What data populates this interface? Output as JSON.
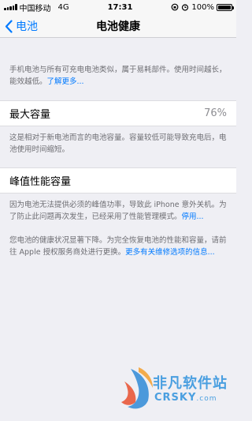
{
  "status_bar": {
    "carrier": "中国移动",
    "network": "4G",
    "time": "17:31",
    "battery_percent": "100%",
    "battery_level": 1.0
  },
  "nav": {
    "back_label": "电池",
    "title": "电池健康"
  },
  "intro": {
    "text": "手机电池与所有可充电电池类似，属于易耗部件。使用时间越长，能效越低。",
    "link": "了解更多..."
  },
  "max_capacity": {
    "label": "最大容量",
    "value": "76%",
    "desc": "这是相对于新电池而言的电池容量。容量较低可能导致充电后，电池使用时间缩短。"
  },
  "peak_performance": {
    "label": "峰值性能容量",
    "desc": "因为电池无法提供必须的峰值功率，导致此 iPhone 意外关机。为了防止此问题再次发生，已经采用了性能管理模式。",
    "desc_link": "停用...",
    "health_desc": "您电池的健康状况显著下降。为完全恢复电池的性能和容量，请前往 Apple 授权服务商处进行更换。",
    "health_link": "更多有关维修选项的信息..."
  },
  "watermark": {
    "cn": "非凡软件站",
    "en": "CRSKY",
    "suffix": ".com"
  },
  "colors": {
    "accent": "#007aff",
    "background": "#efeff4",
    "secondary_text": "#6d6d72"
  }
}
